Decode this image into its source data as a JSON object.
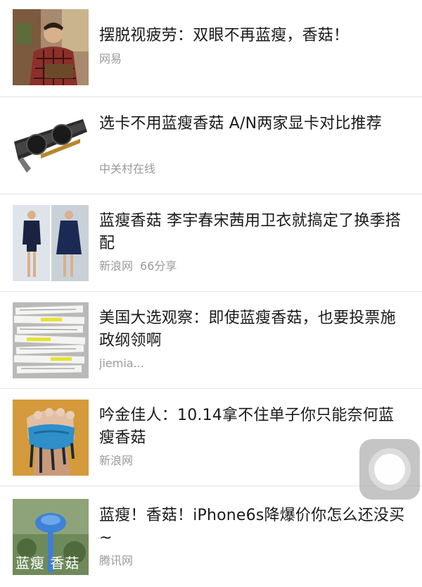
{
  "feed": {
    "items": [
      {
        "title": "摆脱视疲劳：双眼不再蓝瘦，香菇！",
        "source": "网易",
        "shares": ""
      },
      {
        "title": "选卡不用蓝瘦香菇 A/N两家显卡对比推荐",
        "source": "中关村在线",
        "shares": ""
      },
      {
        "title": "蓝瘦香菇 李宇春宋茜用卫衣就搞定了换季搭配",
        "source": "新浪网",
        "shares": "66分享"
      },
      {
        "title": "美国大选观察：即使蓝瘦香菇，也要投票施政纲领啊",
        "source": "jiemia...",
        "shares": ""
      },
      {
        "title": "吟金佳人：10.14拿不住单子你只能奈何蓝瘦香菇",
        "source": "新浪网",
        "shares": ""
      },
      {
        "title": "蓝瘦！香菇！iPhone6s降爆价你怎么还没买~",
        "source": "腾讯网",
        "shares": "",
        "thumb_caption": "蓝瘦 香菇"
      }
    ]
  },
  "assistive_touch": {
    "icon": "assistive-touch-icon"
  }
}
